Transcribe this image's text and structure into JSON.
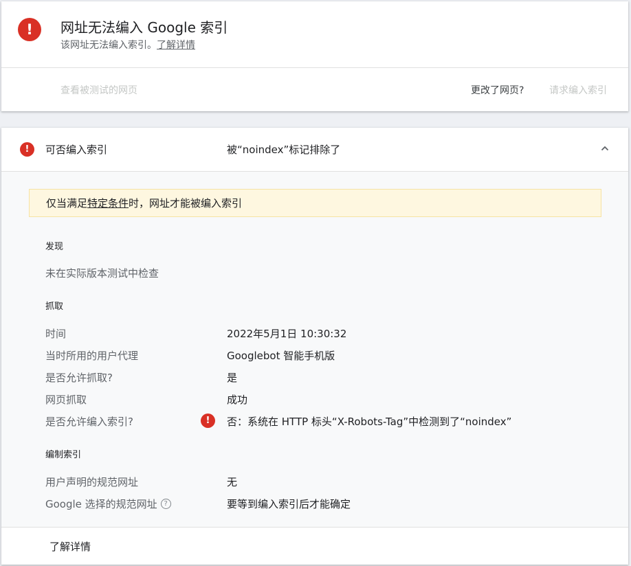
{
  "status_card": {
    "title": "网址无法编入 Google 索引",
    "subtitle": "该网址无法编入索引。",
    "learn_more": "了解详情",
    "view_tested_page": "查看被测试的网页",
    "page_changed": "更改了网页?",
    "request_indexing": "请求编入索引",
    "error_icon_glyph": "!"
  },
  "indexability": {
    "label": "可否编入索引",
    "value": "被“noindex”标记排除了",
    "notice": {
      "prefix": "仅当满足",
      "link": "特定条件",
      "suffix": "时，网址才能被编入索引"
    },
    "discovery": {
      "title": "发现",
      "text": "未在实际版本测试中检查"
    },
    "crawl": {
      "title": "抓取",
      "rows": [
        {
          "label": "时间",
          "value": "2022年5月1日 10:30:32"
        },
        {
          "label": "当时所用的用户代理",
          "value": "Googlebot 智能手机版"
        },
        {
          "label": "是否允许抓取?",
          "value": "是"
        },
        {
          "label": "网页抓取",
          "value": "成功"
        },
        {
          "label": "是否允许编入索引?",
          "value": "否：系统在 HTTP 标头“X-Robots-Tag”中检测到了“noindex”"
        }
      ]
    },
    "indexing": {
      "title": "编制索引",
      "rows": [
        {
          "label": "用户声明的规范网址",
          "value": "无"
        },
        {
          "label": "Google 选择的规范网址",
          "value": "要等到编入索引后才能确定"
        }
      ]
    },
    "help_glyph": "?",
    "footer_link": "了解详情"
  },
  "colors": {
    "error_red": "#d93025",
    "notice_bg": "#fef7e0",
    "muted_text": "#5f6368",
    "disabled_text": "#c4c7c5"
  }
}
